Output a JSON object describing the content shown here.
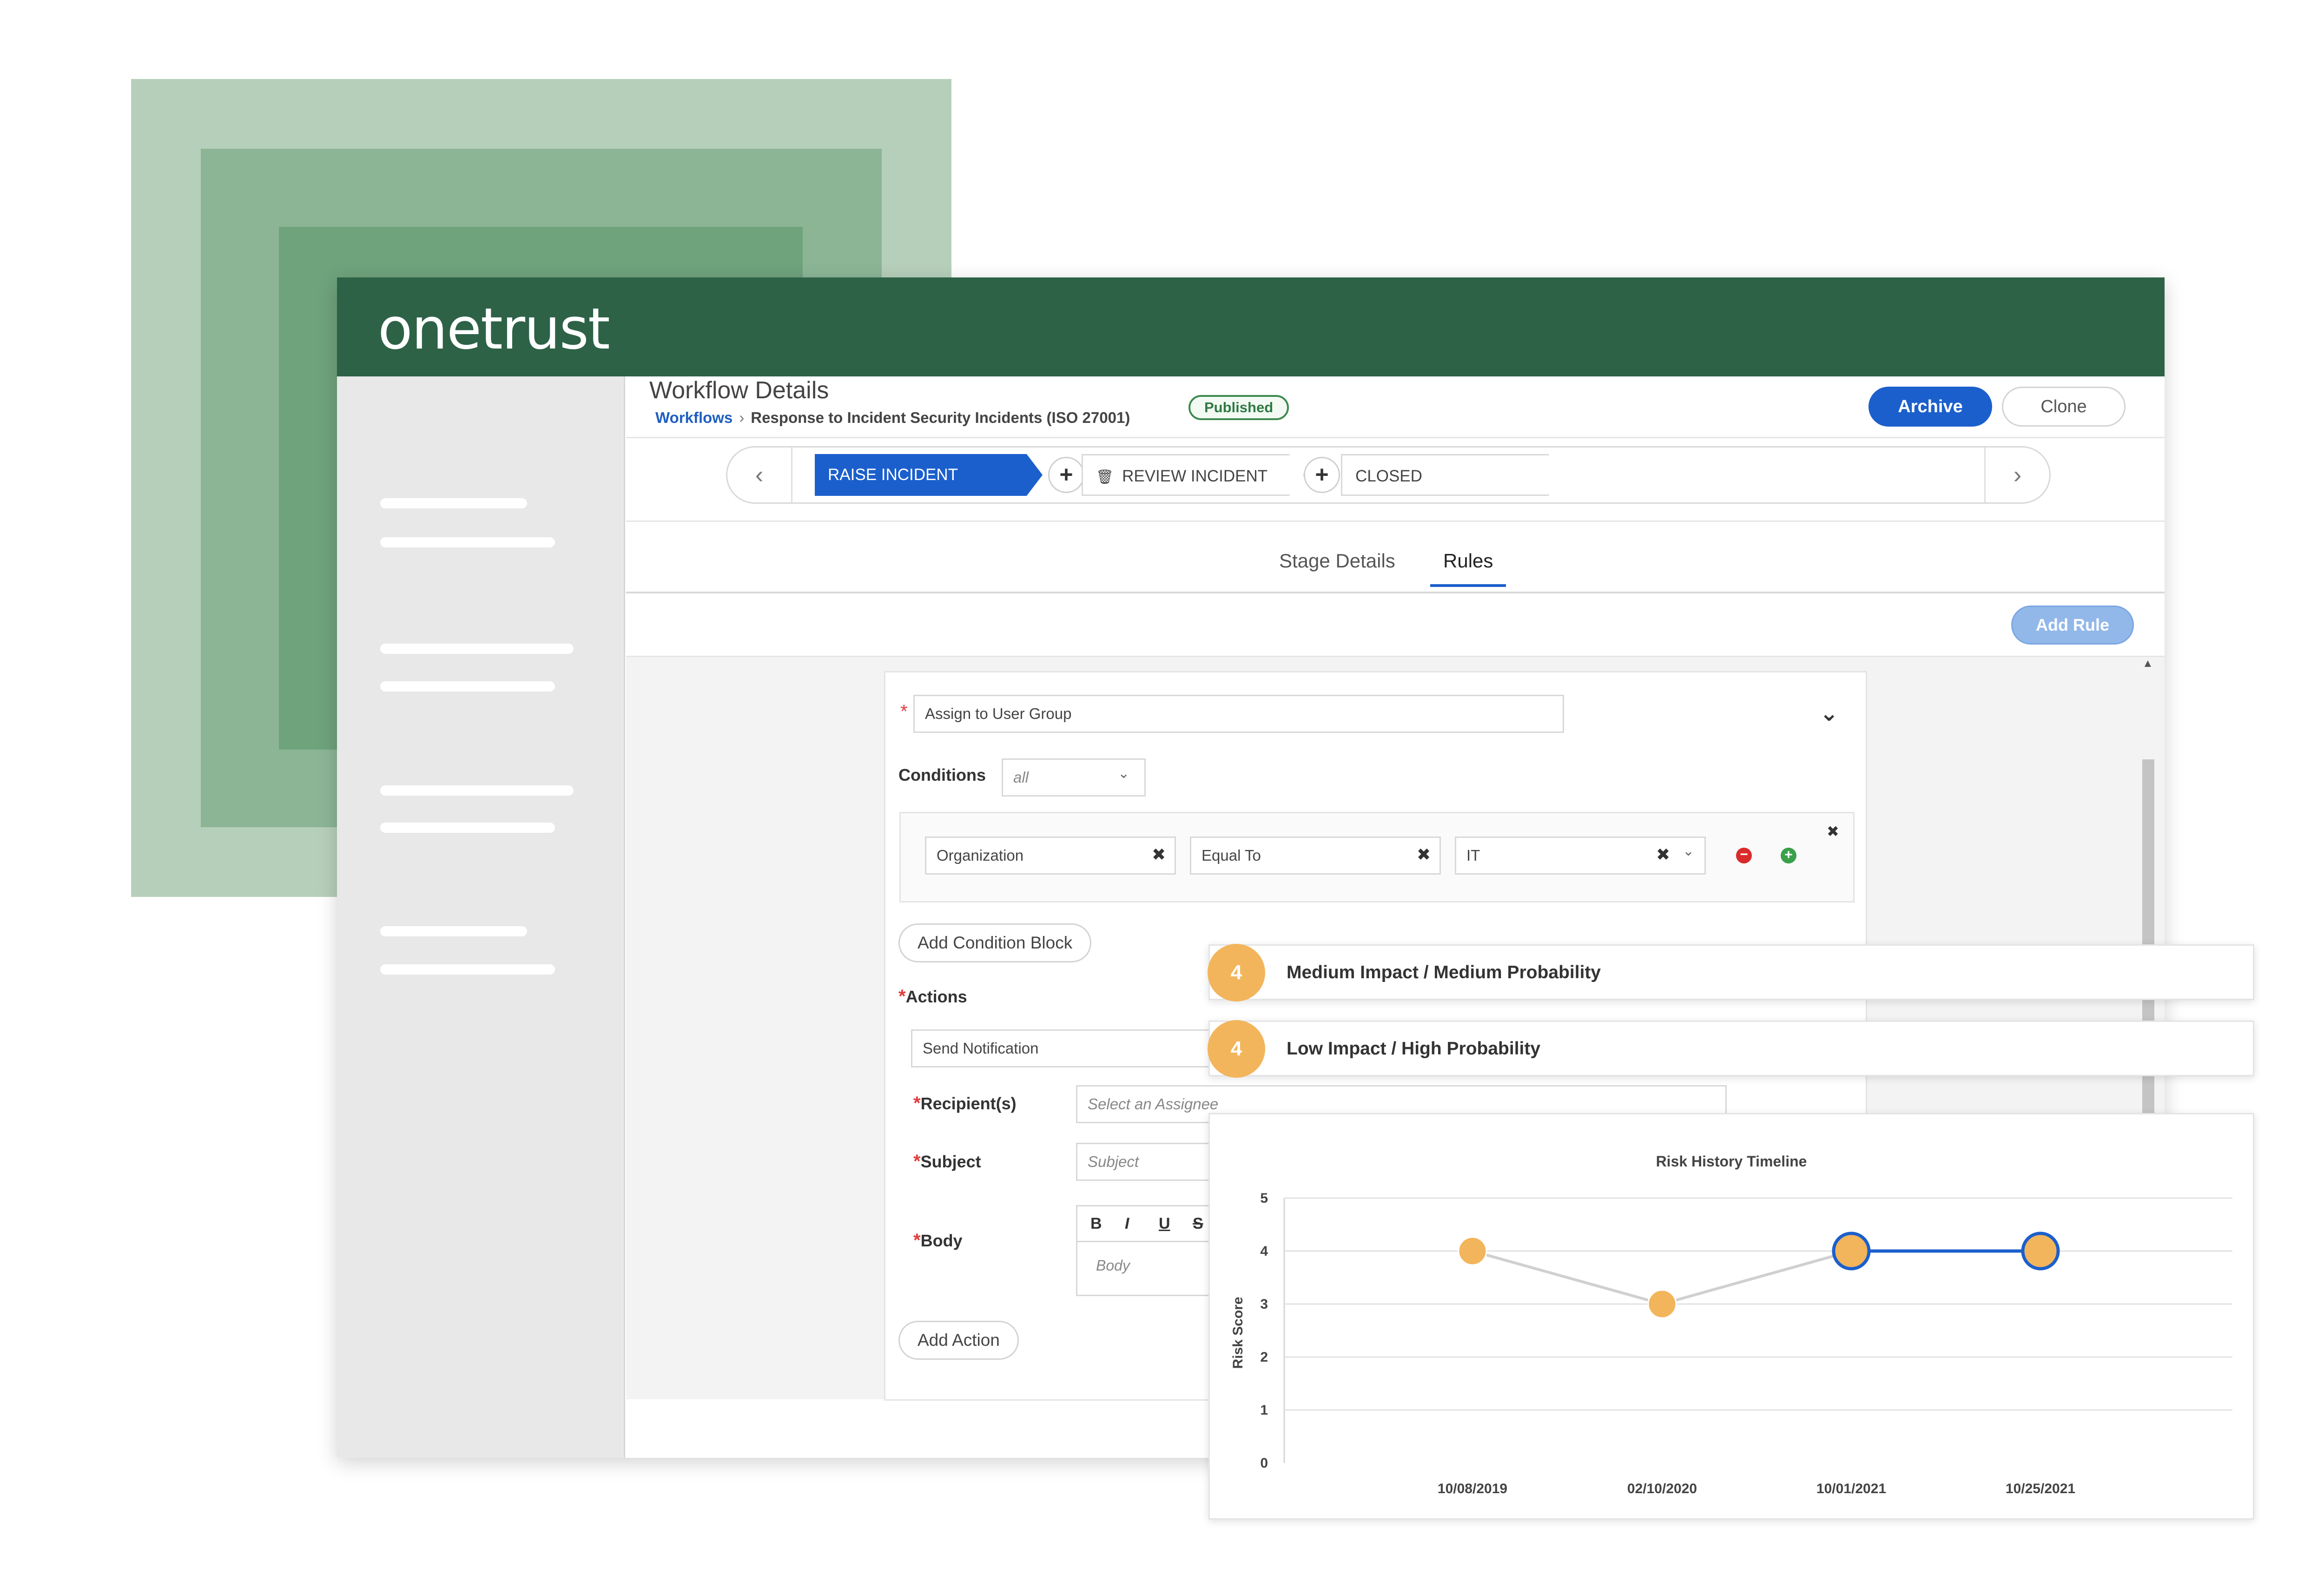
{
  "app": {
    "logo_text": "onetrust"
  },
  "page": {
    "title": "Workflow Details",
    "breadcrumb": {
      "link": "Workflows",
      "current": "Response to Incident Security Incidents (ISO 27001)"
    },
    "status_badge": "Published",
    "archive_label": "Archive",
    "clone_label": "Clone"
  },
  "stages": {
    "items": [
      "RAISE INCIDENT",
      "REVIEW INCIDENT",
      "CLOSED"
    ],
    "active_index": 0
  },
  "tabs": [
    "Stage Details",
    "Rules"
  ],
  "toolbar": {
    "add_rule_label": "Add Rule"
  },
  "rule": {
    "name_value": "Assign to User Group",
    "conditions_label": "Conditions",
    "conditions_select_placeholder": "all",
    "condition": {
      "field": "Organization",
      "operator": "Equal To",
      "value": "IT"
    },
    "add_condition_block_label": "Add Condition Block",
    "actions_label": "Actions",
    "action_value": "Send Notification",
    "recipients_label": "Recipient(s)",
    "recipients_placeholder": "Select an Assignee",
    "subject_label": "Subject",
    "subject_placeholder": "Subject",
    "body_label": "Body",
    "body_placeholder": "Body",
    "rte_buttons": [
      "B",
      "I",
      "U",
      "S"
    ],
    "add_action_label": "Add Action"
  },
  "risk_cards": [
    {
      "score": "4",
      "label": "Medium Impact / Medium Probability"
    },
    {
      "score": "4",
      "label": "Low Impact / High Probability"
    }
  ],
  "colors": {
    "brand_green": "#2d6247",
    "primary_blue": "#1b5fcc",
    "risk_orange": "#f2b55c"
  },
  "chart_data": {
    "type": "line",
    "title": "Risk History Timeline",
    "xlabel": "",
    "ylabel": "Risk Score",
    "categories": [
      "10/08/2019",
      "02/10/2020",
      "10/01/2021",
      "10/25/2021"
    ],
    "values": [
      4,
      3,
      4,
      4
    ],
    "ylim": [
      0,
      5
    ],
    "yticks": [
      "0",
      "1",
      "2",
      "3",
      "4",
      "5"
    ],
    "grid": true,
    "colors": {
      "line_gray": "#d0d0d0",
      "line_blue": "#1b5fcc",
      "point_fill": "#f2b55c"
    }
  }
}
